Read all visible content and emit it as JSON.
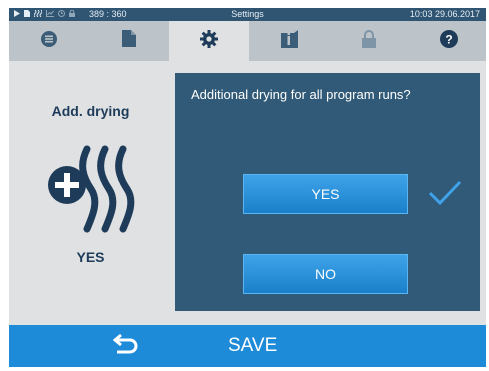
{
  "statusbar": {
    "coords": "389 : 360",
    "title": "Settings",
    "time": "10:03 29.06.2017",
    "icons": [
      "play-icon",
      "document-small-icon",
      "drying-small-icon",
      "chart-small-icon",
      "clock-small-icon",
      "lock-small-icon"
    ]
  },
  "tabs": [
    {
      "icon": "list-icon",
      "active": false
    },
    {
      "icon": "document-icon",
      "active": false
    },
    {
      "icon": "gear-icon",
      "active": true
    },
    {
      "icon": "info-icon",
      "active": false
    },
    {
      "icon": "lock-icon",
      "active": false
    },
    {
      "icon": "help-icon",
      "active": false
    }
  ],
  "left_panel": {
    "title": "Add. drying",
    "icon": "additional-drying-icon",
    "value": "YES"
  },
  "dialog": {
    "question": "Additional drying for all program runs?",
    "yes_label": "YES",
    "no_label": "NO",
    "selected": "YES",
    "selected_icon": "checkmark-icon"
  },
  "bottombar": {
    "back_icon": "back-arrow-icon",
    "save_label": "SAVE"
  },
  "colors": {
    "statusbar": "#2f5572",
    "tabbar": "#bcc4c9",
    "background": "#dfe1e2",
    "dialog": "#305a77",
    "button": "#2a93dd",
    "bottombar": "#1e8bd8",
    "accent_text": "#1e3c5a"
  }
}
